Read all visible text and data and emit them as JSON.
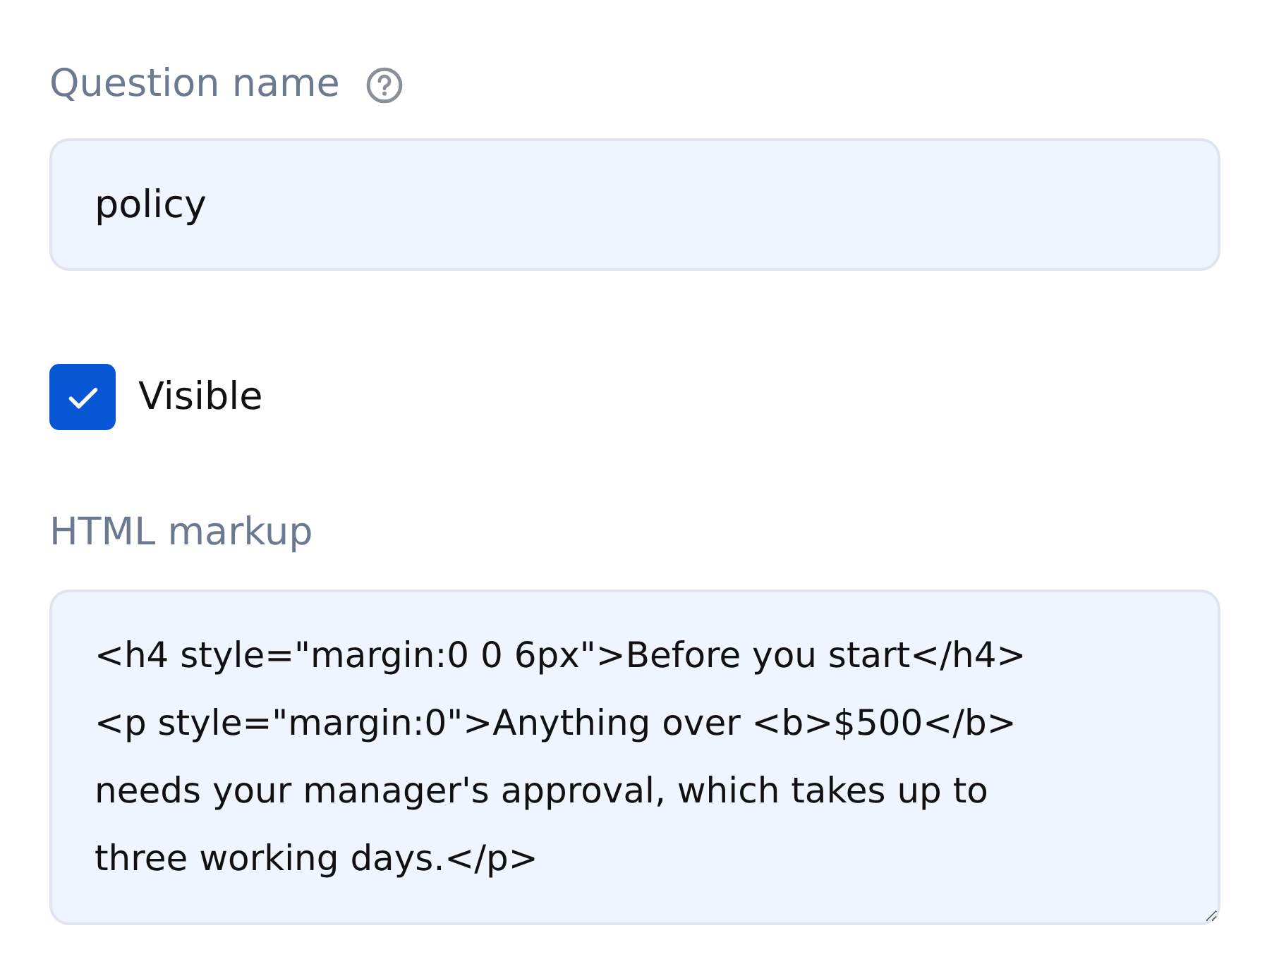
{
  "name_field": {
    "label": "Question name",
    "value": "policy"
  },
  "visible": {
    "label": "Visible",
    "checked": true
  },
  "markup_field": {
    "label": "HTML markup",
    "value": "<h4 style=\"margin:0 0 6px\">Before you start</h4>\n<p style=\"margin:0\">Anything over <b>$500</b>\nneeds your manager's approval, which takes up to\nthree working days.</p>"
  }
}
